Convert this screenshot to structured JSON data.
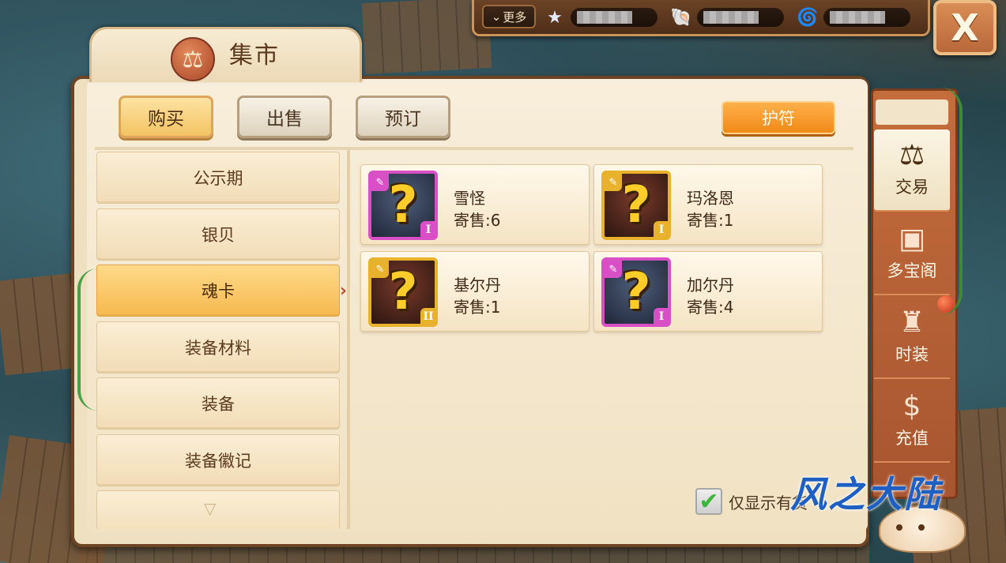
{
  "topbar": {
    "more_label": "更多",
    "resources": [
      {
        "icon": "star-icon",
        "glyph": "★",
        "value": ""
      },
      {
        "icon": "shell-icon",
        "glyph": "🐚",
        "value": ""
      },
      {
        "icon": "conch-icon",
        "glyph": "🌀",
        "value": ""
      }
    ],
    "close_label": "X"
  },
  "title": {
    "text": "集市",
    "emblem": "⚖"
  },
  "tabs": [
    {
      "label": "购买",
      "active": true
    },
    {
      "label": "出售",
      "active": false
    },
    {
      "label": "预订",
      "active": false
    }
  ],
  "amulet_button": "护符",
  "categories": [
    {
      "label": "公示期",
      "active": false
    },
    {
      "label": "银贝",
      "active": false
    },
    {
      "label": "魂卡",
      "active": true
    },
    {
      "label": "装备材料",
      "active": false
    },
    {
      "label": "装备",
      "active": false
    },
    {
      "label": "装备徽记",
      "active": false
    }
  ],
  "items": [
    {
      "name": "雪怪",
      "count": "寄售:6",
      "tier": "I",
      "frame": "purple"
    },
    {
      "name": "玛洛恩",
      "count": "寄售:1",
      "tier": "I",
      "frame": "gold"
    },
    {
      "name": "基尔丹",
      "count": "寄售:1",
      "tier": "II",
      "frame": "gold"
    },
    {
      "name": "加尔丹",
      "count": "寄售:4",
      "tier": "I",
      "frame": "purple"
    }
  ],
  "filter": {
    "label": "仅显示有货",
    "checked": true
  },
  "sidebar": [
    {
      "label": "交易",
      "icon": "scale-icon",
      "glyph": "⚖",
      "active": true
    },
    {
      "label": "多宝阁",
      "icon": "treasure-chest-icon",
      "glyph": "▣",
      "active": false
    },
    {
      "label": "时装",
      "icon": "outfit-icon",
      "glyph": "♜",
      "active": false
    },
    {
      "label": "充值",
      "icon": "dollar-icon",
      "glyph": "$",
      "active": false
    }
  ],
  "watermark": "风之大陆"
}
